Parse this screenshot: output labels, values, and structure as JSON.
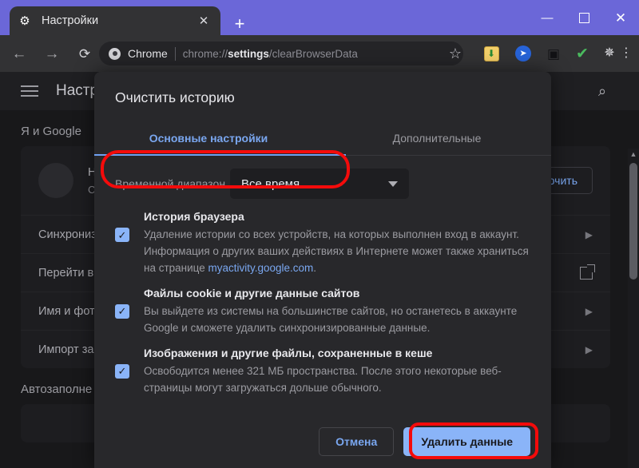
{
  "window": {
    "minimize_label": "—",
    "maximize_label": "□",
    "close_label": "✕"
  },
  "tabstrip": {
    "tab": {
      "favicon": "gear-icon",
      "title": "Настройки",
      "close_label": "✕"
    },
    "new_tab_label": "+"
  },
  "toolbar": {
    "back_label": "←",
    "forward_label": "→",
    "reload_label": "⟳",
    "omnibox": {
      "brand": "Chrome",
      "url_prefix": "chrome://",
      "url_bold": "settings",
      "url_suffix": "/clearBrowserData"
    },
    "bookmark_label": "☆",
    "ext_download_label": "⬇",
    "ext_share_label": "➤",
    "ext_camera_label": "▣",
    "ext_shield_label": "✔",
    "ext_puzzle_label": "✵",
    "menu_label": "⋮"
  },
  "page": {
    "header_title": "Настр",
    "search_label": "⌕",
    "section_google": "Я и Google",
    "profile": {
      "line1": "Н",
      "line2": "С",
      "turn_on_label": "лючить"
    },
    "rows": [
      {
        "label": "Синхрониз",
        "trailing": "▶"
      },
      {
        "label": "Перейти в",
        "trailing": "extlink"
      },
      {
        "label": "Имя и фот",
        "trailing": "▶"
      },
      {
        "label": "Импорт за",
        "trailing": "▶"
      }
    ],
    "section_autofill": "Автозаполне",
    "scroll_up_label": "▲"
  },
  "dialog": {
    "title": "Очистить историю",
    "tabs": [
      {
        "label": "Основные настройки",
        "active": true
      },
      {
        "label": "Дополнительные",
        "active": false
      }
    ],
    "range": {
      "label": "Временной диапазон",
      "value": "Все время"
    },
    "options": [
      {
        "checked_mark": "✓",
        "title": "История браузера",
        "desc_before": "Удаление истории со всех устройств, на которых выполнен вход в аккаунт. Информация о других ваших действиях в Интернете может также храниться на странице ",
        "link": "myactivity.google.com",
        "desc_after": "."
      },
      {
        "checked_mark": "✓",
        "title": "Файлы cookie и другие данные сайтов",
        "desc_before": "Вы выйдете из системы на большинстве сайтов, но останетесь в аккаунте Google и сможете удалить синхронизированные данные.",
        "link": "",
        "desc_after": ""
      },
      {
        "checked_mark": "✓",
        "title": "Изображения и другие файлы, сохраненные в кеше",
        "desc_before": "Освободится менее 321 МБ пространства. После этого некоторые веб-страницы могут загружаться дольше обычного.",
        "link": "",
        "desc_after": ""
      }
    ],
    "cancel_label": "Отмена",
    "delete_label": "Удалить данные"
  },
  "colors": {
    "accent_purple": "#6b67d8",
    "accent_blue": "#8ab4f8",
    "annotation_red": "#f40b0b"
  }
}
